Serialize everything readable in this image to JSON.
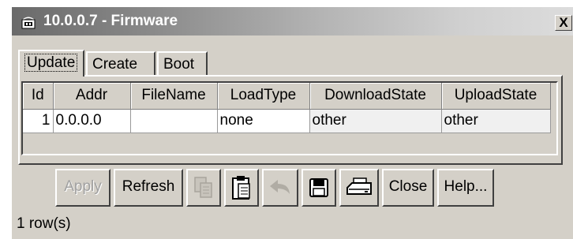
{
  "window": {
    "title": "10.0.0.7 - Firmware",
    "close_label": "X"
  },
  "tabs": [
    {
      "label": "Update",
      "active": true
    },
    {
      "label": "Create",
      "active": false
    },
    {
      "label": "Boot",
      "active": false
    }
  ],
  "table": {
    "columns": [
      "Id",
      "Addr",
      "FileName",
      "LoadType",
      "DownloadState",
      "UploadState"
    ],
    "rows": [
      {
        "id": "1",
        "addr": "0.0.0.0",
        "filename": "",
        "loadtype": "none",
        "downloadstate": "other",
        "uploadstate": "other"
      }
    ]
  },
  "toolbar": {
    "apply_label": "Apply",
    "refresh_label": "Refresh",
    "copy_icon": "copy-icon",
    "paste_icon": "paste-icon",
    "undo_icon": "undo-icon",
    "save_icon": "save-icon",
    "print_icon": "print-icon",
    "close_label": "Close",
    "help_label": "Help..."
  },
  "status": {
    "text": "1 row(s)"
  },
  "colors": {
    "face": "#d4d0c8",
    "highlight": "#ffffff",
    "shadow": "#404040"
  }
}
